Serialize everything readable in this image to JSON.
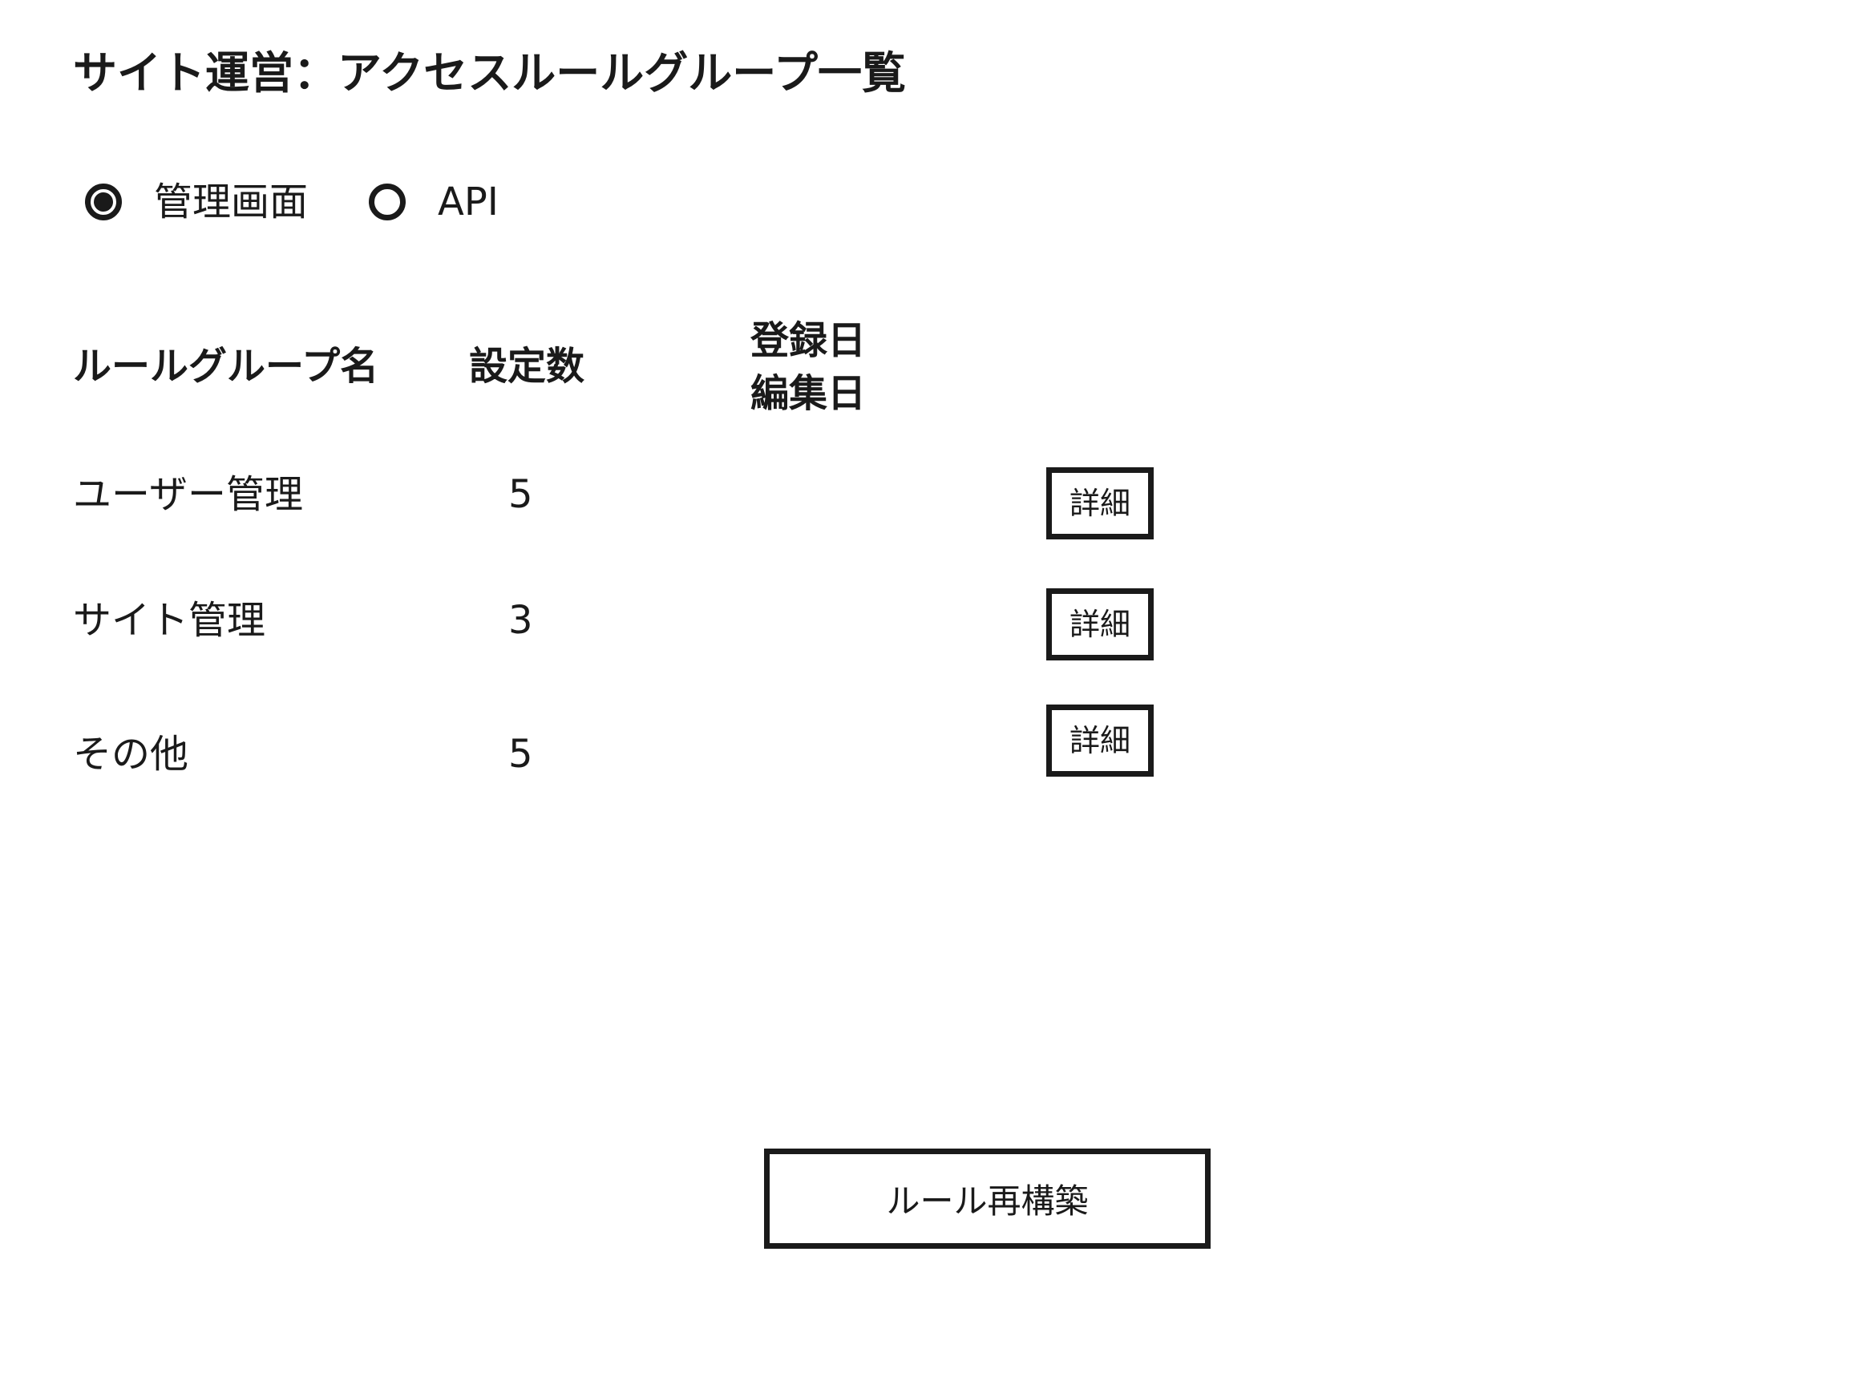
{
  "page": {
    "title": "サイト運営：アクセスルールグループ一覧"
  },
  "tabs": {
    "options": [
      {
        "label": "管理画面",
        "selected": true
      },
      {
        "label": "API",
        "selected": false
      }
    ]
  },
  "table": {
    "headers": {
      "name": "ルールグループ名",
      "count": "設定数",
      "registered": "登録日",
      "edited": "編集日"
    },
    "rows": [
      {
        "name": "ユーザー管理",
        "count": "5",
        "registered": "",
        "edited": "",
        "action": "詳細"
      },
      {
        "name": "サイト管理",
        "count": "3",
        "registered": "",
        "edited": "",
        "action": "詳細"
      },
      {
        "name": "その他",
        "count": "5",
        "registered": "",
        "edited": "",
        "action": "詳細"
      }
    ]
  },
  "footer": {
    "rebuild_label": "ルール再構築"
  },
  "colors": {
    "text": "#1a1a1a",
    "background": "#ffffff",
    "border": "#1a1a1a"
  }
}
